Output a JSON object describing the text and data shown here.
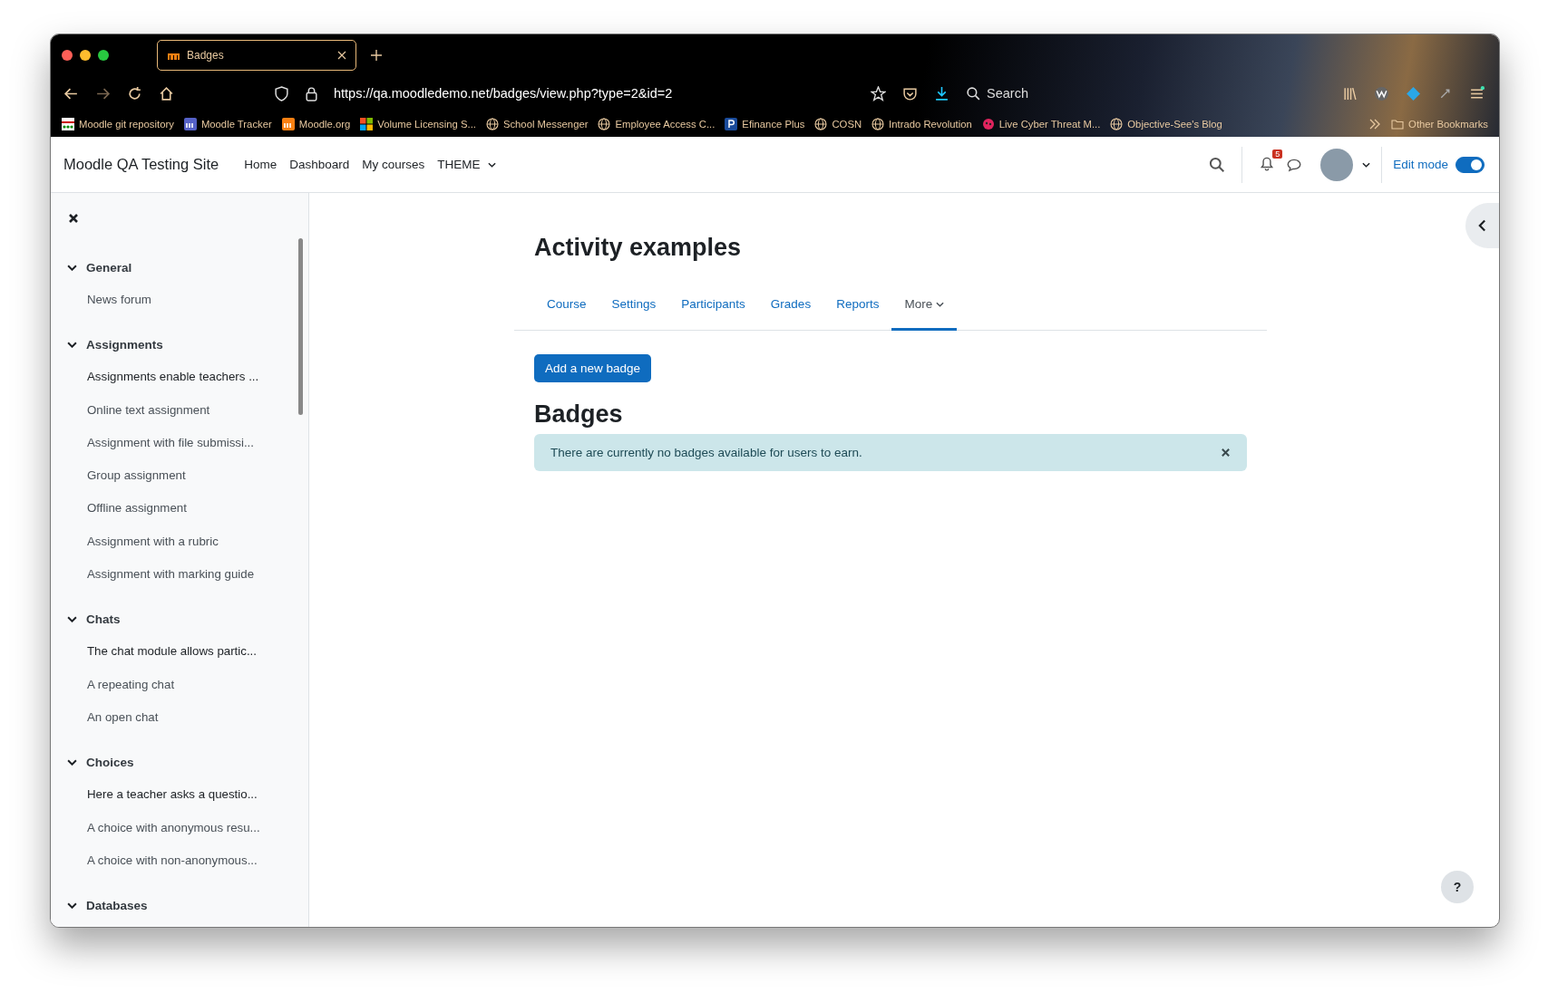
{
  "browser": {
    "tab": {
      "title": "Badges"
    },
    "address": "https://qa.moodledemo.net/badges/view.php?type=2&id=2",
    "search": {
      "placeholder": "Search"
    },
    "bookmarks": [
      {
        "label": "Moodle git repository",
        "kind": "grid"
      },
      {
        "label": "Moodle Tracker",
        "kind": "tracker"
      },
      {
        "label": "Moodle.org",
        "kind": "moodle"
      },
      {
        "label": "Volume Licensing S...",
        "kind": "windows"
      },
      {
        "label": "School Messenger",
        "kind": "globe"
      },
      {
        "label": "Employee Access C...",
        "kind": "globe"
      },
      {
        "label": "Efinance Plus",
        "kind": "letter"
      },
      {
        "label": "COSN",
        "kind": "globe"
      },
      {
        "label": "Intrado Revolution",
        "kind": "globe"
      },
      {
        "label": "Live Cyber Threat M...",
        "kind": "dot"
      },
      {
        "label": "Objective-See's Blog",
        "kind": "globe"
      }
    ],
    "other_bookmarks": "Other Bookmarks"
  },
  "navbar": {
    "site_name": "Moodle QA Testing Site",
    "links": [
      "Home",
      "Dashboard",
      "My courses"
    ],
    "theme_menu": "THEME",
    "notification_count": "5",
    "edit_mode": {
      "label": "Edit mode",
      "on": true
    }
  },
  "sidebar": {
    "sections": [
      {
        "title": "General",
        "expanded": true,
        "items": [
          {
            "label": "News forum",
            "kind": "activity"
          }
        ]
      },
      {
        "title": "Assignments",
        "expanded": true,
        "items": [
          {
            "label": "Assignments enable teachers ...",
            "kind": "intro"
          },
          {
            "label": "Online text assignment",
            "kind": "activity"
          },
          {
            "label": "Assignment with file submissi...",
            "kind": "activity"
          },
          {
            "label": "Group assignment",
            "kind": "activity"
          },
          {
            "label": "Offline assignment",
            "kind": "activity"
          },
          {
            "label": "Assignment with a rubric",
            "kind": "activity"
          },
          {
            "label": "Assignment with marking guide",
            "kind": "activity"
          }
        ]
      },
      {
        "title": "Chats",
        "expanded": true,
        "items": [
          {
            "label": "The chat module allows partic...",
            "kind": "intro"
          },
          {
            "label": "A repeating chat",
            "kind": "activity"
          },
          {
            "label": "An open chat",
            "kind": "activity"
          }
        ]
      },
      {
        "title": "Choices",
        "expanded": true,
        "items": [
          {
            "label": "Here a teacher asks a questio...",
            "kind": "intro"
          },
          {
            "label": "A choice with anonymous resu...",
            "kind": "activity"
          },
          {
            "label": "A choice with non-anonymous...",
            "kind": "activity"
          }
        ]
      },
      {
        "title": "Databases",
        "expanded": true
      }
    ]
  },
  "page": {
    "title": "Activity examples",
    "tabs": [
      {
        "label": "Course",
        "selected": false
      },
      {
        "label": "Settings",
        "selected": false
      },
      {
        "label": "Participants",
        "selected": false
      },
      {
        "label": "Grades",
        "selected": false
      },
      {
        "label": "Reports",
        "selected": false
      },
      {
        "label": "More",
        "selected": true
      }
    ],
    "add_button": "Add a new badge",
    "heading": "Badges",
    "alert": "There are currently no badges available for users to earn.",
    "help_button": "?"
  }
}
